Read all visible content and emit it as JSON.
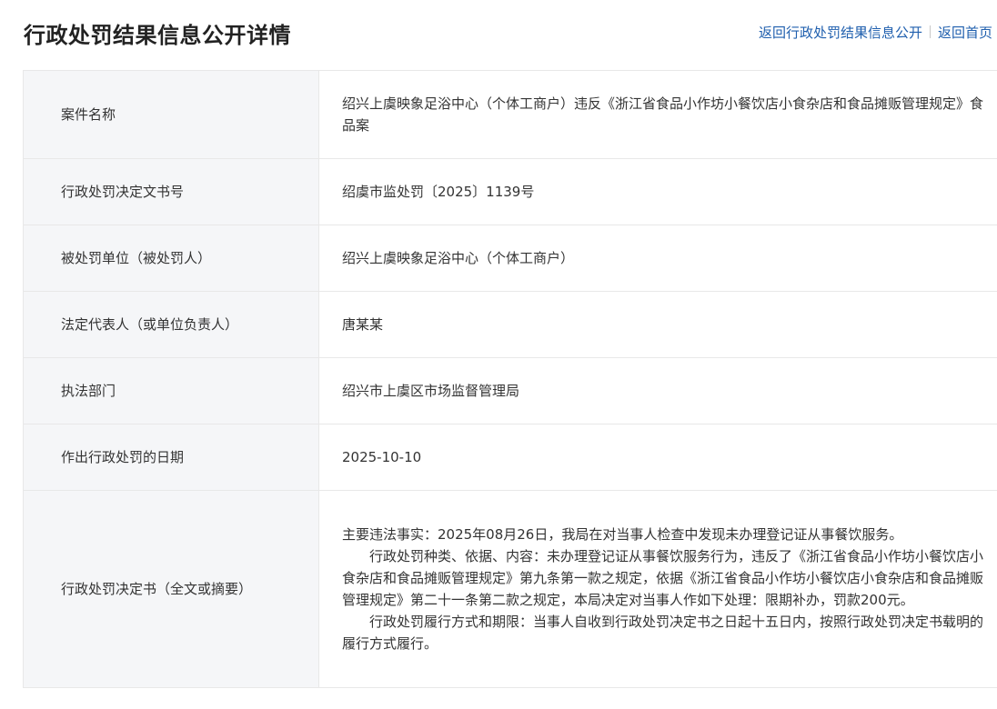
{
  "header": {
    "title": "行政处罚结果信息公开详情",
    "links": [
      {
        "label": "返回行政处罚结果信息公开"
      },
      {
        "label": "返回首页"
      }
    ]
  },
  "rows": [
    {
      "label": "案件名称",
      "value": "绍兴上虞映象足浴中心（个体工商户）违反《浙江省食品小作坊小餐饮店小食杂店和食品摊贩管理规定》食品案"
    },
    {
      "label": "行政处罚决定文书号",
      "value": "绍虞市监处罚〔2025〕1139号"
    },
    {
      "label": "被处罚单位（被处罚人）",
      "value": "绍兴上虞映象足浴中心（个体工商户）"
    },
    {
      "label": "法定代表人（或单位负责人）",
      "value": "唐某某"
    },
    {
      "label": "执法部门",
      "value": "绍兴市上虞区市场监督管理局"
    },
    {
      "label": "作出行政处罚的日期",
      "value": "2025-10-10"
    },
    {
      "label": "行政处罚决定书（全文或摘要）",
      "paragraphs": [
        "主要违法事实：2025年08月26日，我局在对当事人检查中发现未办理登记证从事餐饮服务。",
        "行政处罚种类、依据、内容：未办理登记证从事餐饮服务行为，违反了《浙江省食品小作坊小餐饮店小食杂店和食品摊贩管理规定》第九条第一款之规定，依据《浙江省食品小作坊小餐饮店小食杂店和食品摊贩管理规定》第二十一条第二款之规定，本局决定对当事人作如下处理：限期补办，罚款200元。",
        "行政处罚履行方式和期限：当事人自收到行政处罚决定书之日起十五日内，按照行政处罚决定书载明的履行方式履行。"
      ]
    }
  ]
}
